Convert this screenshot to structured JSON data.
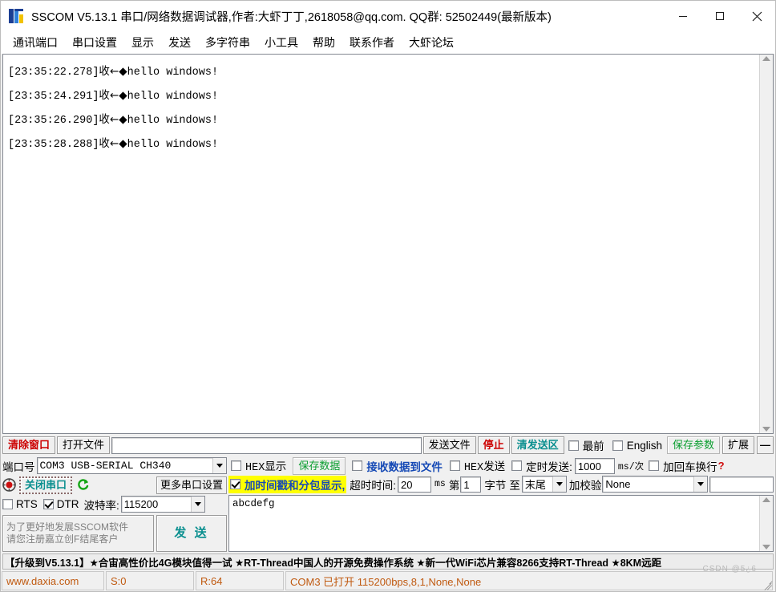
{
  "window": {
    "title": "SSCOM V5.13.1 串口/网络数据调试器,作者:大虾丁丁,2618058@qq.com. QQ群: 52502449(最新版本)",
    "minimize": "–",
    "maximize": "▢",
    "close": "✕"
  },
  "menu": {
    "items": [
      {
        "label": "通讯端口"
      },
      {
        "label": "串口设置"
      },
      {
        "label": "显示"
      },
      {
        "label": "发送"
      },
      {
        "label": "多字符串"
      },
      {
        "label": "小工具"
      },
      {
        "label": "帮助"
      },
      {
        "label": "联系作者"
      },
      {
        "label": "大虾论坛"
      }
    ]
  },
  "receive": {
    "lines": [
      {
        "time": "[23:35:22.278]",
        "dir": "收←◆",
        "text": "hello windows!"
      },
      {
        "time": "[23:35:24.291]",
        "dir": "收←◆",
        "text": "hello windows!"
      },
      {
        "time": "[23:35:26.290]",
        "dir": "收←◆",
        "text": "hello windows!"
      },
      {
        "time": "[23:35:28.288]",
        "dir": "收←◆",
        "text": "hello windows!"
      }
    ]
  },
  "toolbar": {
    "clear_window": "清除窗口",
    "open_file": "打开文件",
    "file_path_value": "",
    "send_file": "发送文件",
    "stop": "停止",
    "clear_send": "清发送区",
    "topmost_label": "最前",
    "topmost_checked": false,
    "english_label": "English",
    "english_checked": false,
    "save_params": "保存参数",
    "extend": "扩展",
    "collapse": "—"
  },
  "serial": {
    "port_label": "端口号",
    "port_value": "COM3 USB-SERIAL CH340",
    "close_port_button": "关闭串口",
    "refresh_icon": "refresh-icon",
    "more_settings": "更多串口设置",
    "rts_label": "RTS",
    "rts_checked": false,
    "dtr_label": "DTR",
    "dtr_checked": true,
    "baud_label": "波特率:",
    "baud_value": "115200",
    "promo_line1": "为了更好地发展SSCOM软件",
    "promo_line2": "请您注册嘉立创F结尾客户",
    "send_button": "发 送"
  },
  "recv_opts": {
    "hex_display_label": "HEX显示",
    "hex_display_checked": false,
    "save_data": "保存数据",
    "recv_to_file_label": "接收数据到文件",
    "recv_to_file_checked": false,
    "hex_send_label": "HEX发送",
    "hex_send_checked": false,
    "timed_send_label": "定时发送:",
    "timed_send_checked": false,
    "timed_send_value": "1000",
    "timed_send_unit": "ms/次",
    "crlf_label": "加回车换行",
    "crlf_checked": false,
    "help_mark": "?"
  },
  "pack_opts": {
    "timestamp_label": "加时间戳和分包显示,",
    "timestamp_checked": true,
    "timeout_label": "超时时间:",
    "timeout_value": "20",
    "timeout_unit": "ms",
    "nth_label": "第",
    "nth_value": "1",
    "byte_label": "字节",
    "to_label": "至",
    "to_value": "末尾",
    "checksum_label": "加校验",
    "checksum_value": "None",
    "checksum_extra": ""
  },
  "send_area": {
    "text": "abcdefg"
  },
  "ad": {
    "text": "【升级到V5.13.1】★合宙高性价比4G模块值得一试 ★RT-Thread中国人的开源免费操作系统 ★新一代WiFi芯片兼容8266支持RT-Thread ★8KM远距"
  },
  "status": {
    "site": "www.daxia.com",
    "sent": "S:0",
    "received": "R:64",
    "connection": "COM3 已打开  115200bps,8,1,None,None",
    "watermark": "CSDN @5¿6"
  },
  "colors": {
    "red": "#cc0000",
    "green": "#0a9e2f",
    "teal": "#0a8f8f",
    "blue": "#1549b5",
    "orange": "#c05a10",
    "highlight": "#ffff00"
  }
}
